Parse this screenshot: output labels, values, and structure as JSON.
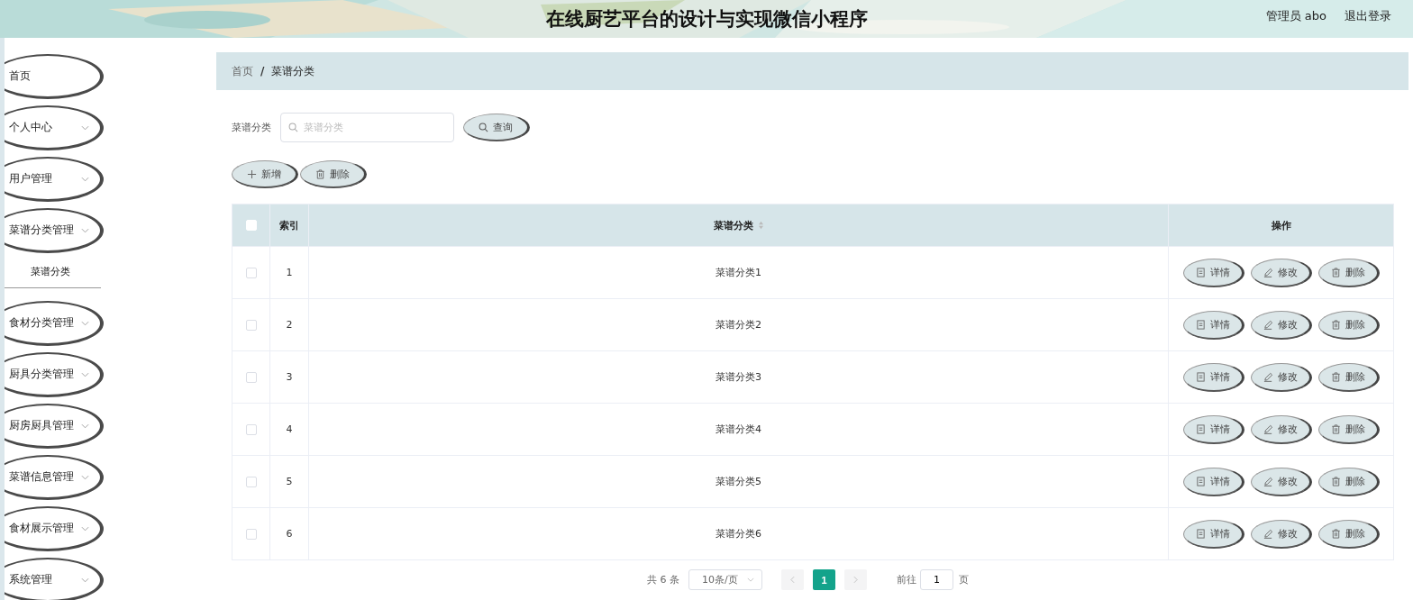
{
  "header": {
    "title": "在线厨艺平台的设计与实现微信小程序",
    "user": "管理员 abo",
    "logout": "退出登录"
  },
  "sidebar": {
    "items": [
      {
        "label": "首页",
        "kind": "link"
      },
      {
        "label": "个人中心",
        "kind": "menu"
      },
      {
        "label": "用户管理",
        "kind": "menu"
      },
      {
        "label": "菜谱分类管理",
        "kind": "menu",
        "children": [
          {
            "label": "菜谱分类",
            "selected": true
          }
        ]
      },
      {
        "label": "食材分类管理",
        "kind": "menu"
      },
      {
        "label": "厨具分类管理",
        "kind": "menu"
      },
      {
        "label": "厨房厨具管理",
        "kind": "menu"
      },
      {
        "label": "菜谱信息管理",
        "kind": "menu"
      },
      {
        "label": "食材展示管理",
        "kind": "menu"
      },
      {
        "label": "系统管理",
        "kind": "menu"
      }
    ]
  },
  "breadcrumb": {
    "items": [
      "首页",
      "菜谱分类"
    ],
    "separator": "/"
  },
  "search": {
    "label": "菜谱分类",
    "placeholder": "菜谱分类",
    "button": "查询"
  },
  "toolbar": [
    {
      "label": "新增",
      "kind": "add"
    },
    {
      "label": "删除",
      "kind": "delete"
    }
  ],
  "table": {
    "columns": [
      {
        "kind": "check",
        "checked": false
      },
      {
        "label": "索引",
        "kind": "index"
      },
      {
        "label": "菜谱分类",
        "kind": "sortable"
      },
      {
        "label": "操作",
        "kind": "actions"
      }
    ],
    "rows": [
      {
        "checked": false,
        "index": "1",
        "name": "菜谱分类1",
        "actions": [
          {
            "label": "详情",
            "kind": "detail"
          },
          {
            "label": "修改",
            "kind": "edit"
          },
          {
            "label": "删除",
            "kind": "delete"
          }
        ]
      },
      {
        "checked": false,
        "index": "2",
        "name": "菜谱分类2",
        "actions": [
          {
            "label": "详情",
            "kind": "detail"
          },
          {
            "label": "修改",
            "kind": "edit"
          },
          {
            "label": "删除",
            "kind": "delete"
          }
        ]
      },
      {
        "checked": false,
        "index": "3",
        "name": "菜谱分类3",
        "actions": [
          {
            "label": "详情",
            "kind": "detail"
          },
          {
            "label": "修改",
            "kind": "edit"
          },
          {
            "label": "删除",
            "kind": "delete"
          }
        ]
      },
      {
        "checked": false,
        "index": "4",
        "name": "菜谱分类4",
        "actions": [
          {
            "label": "详情",
            "kind": "detail"
          },
          {
            "label": "修改",
            "kind": "edit"
          },
          {
            "label": "删除",
            "kind": "delete"
          }
        ]
      },
      {
        "checked": false,
        "index": "5",
        "name": "菜谱分类5",
        "actions": [
          {
            "label": "详情",
            "kind": "detail"
          },
          {
            "label": "修改",
            "kind": "edit"
          },
          {
            "label": "删除",
            "kind": "delete"
          }
        ]
      },
      {
        "checked": false,
        "index": "6",
        "name": "菜谱分类6",
        "actions": [
          {
            "label": "详情",
            "kind": "detail"
          },
          {
            "label": "修改",
            "kind": "edit"
          },
          {
            "label": "删除",
            "kind": "delete"
          }
        ]
      }
    ]
  },
  "pagination": {
    "total": "共 6 条",
    "page_size": "10条/页",
    "pages": [
      {
        "label": "1",
        "selected": true
      }
    ],
    "goto_label": "前往",
    "goto_value": "1",
    "unit": "页"
  }
}
